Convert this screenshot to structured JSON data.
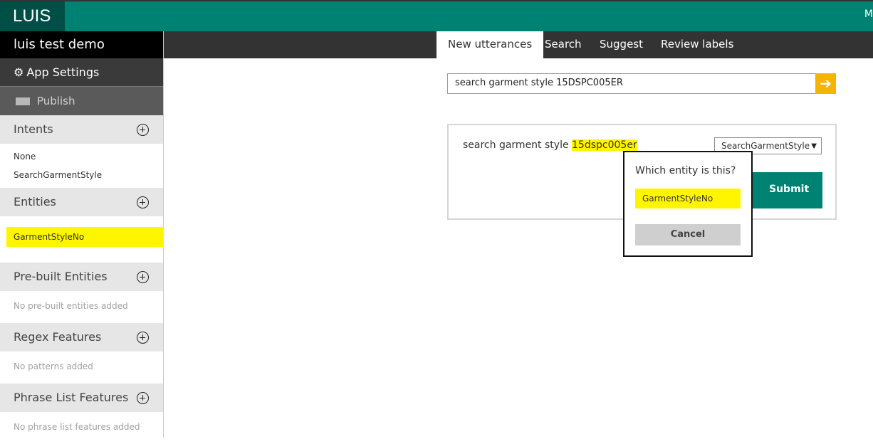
{
  "header": {
    "brand": "LUIS",
    "edge_text": "M"
  },
  "sidebar": {
    "app_name": "luis test demo",
    "app_settings": "App Settings",
    "publish": "Publish",
    "intents": {
      "title": "Intents",
      "items": [
        "None",
        "SearchGarmentStyle"
      ]
    },
    "entities": {
      "title": "Entities",
      "items": [
        "GarmentStyleNo"
      ]
    },
    "prebuilt": {
      "title": "Pre-built Entities",
      "empty": "No pre-built entities added"
    },
    "regex": {
      "title": "Regex Features",
      "empty": "No patterns added"
    },
    "phrase": {
      "title": "Phrase List Features",
      "empty": "No phrase list features added"
    }
  },
  "tabs": [
    "New utterances",
    "Search",
    "Suggest",
    "Review labels"
  ],
  "search": {
    "value": "search garment style 15DSPC005ER"
  },
  "utterance": {
    "text_before": "search garment style ",
    "highlighted": "15dspc005er",
    "intent_selected": "SearchGarmentStyle",
    "submit_label": "Submit"
  },
  "popup": {
    "title": "Which entity is this?",
    "entity_option": "GarmentStyleNo",
    "cancel_label": "Cancel"
  },
  "colors": {
    "accent": "#008272",
    "brand_bg": "#004f47",
    "highlight": "#fff500",
    "go_button": "#f5b400"
  }
}
